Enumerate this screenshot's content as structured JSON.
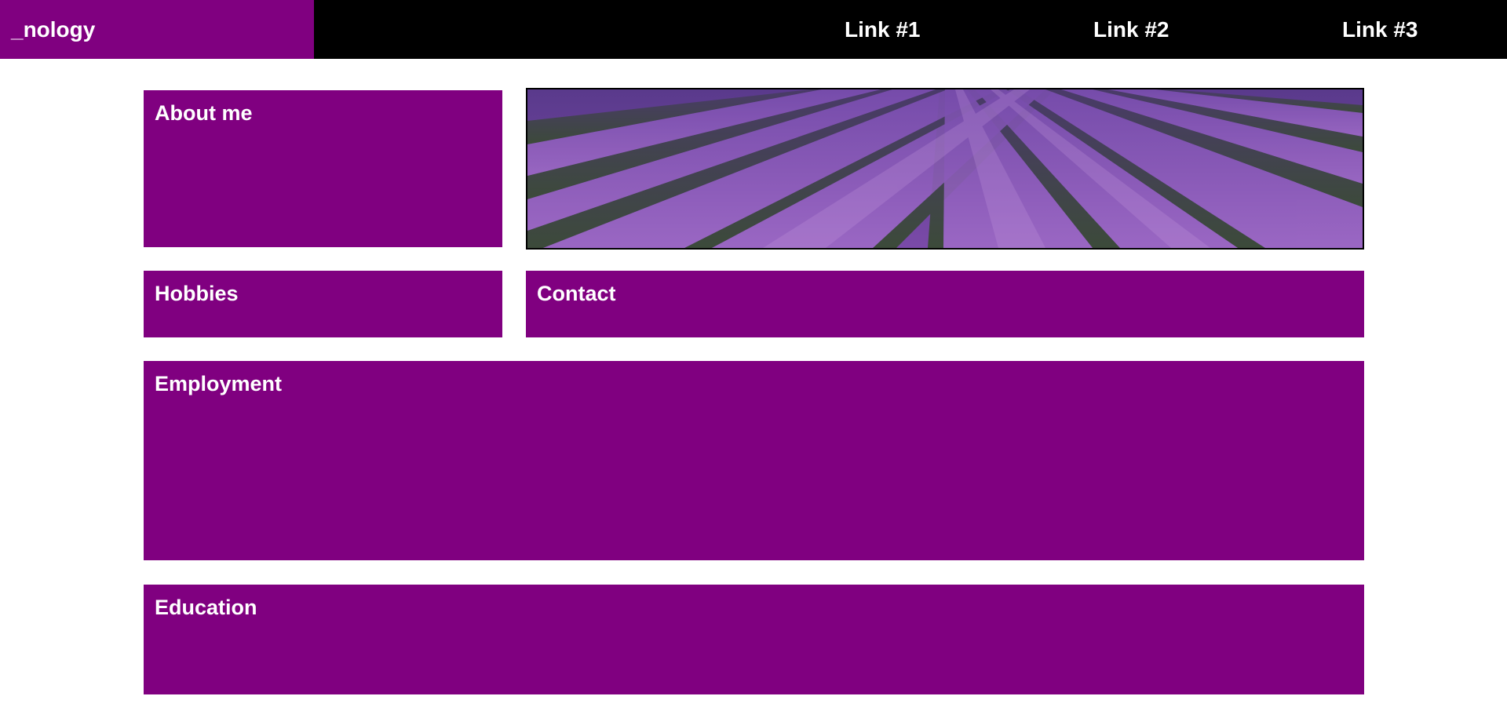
{
  "navbar": {
    "brand": "_nology",
    "links": [
      "Link #1",
      "Link #2",
      "Link #3"
    ]
  },
  "sections": {
    "about": "About me",
    "hobbies": "Hobbies",
    "contact": "Contact",
    "employment": "Employment",
    "education": "Education"
  },
  "hero": {
    "image": "lavender-field"
  },
  "colors": {
    "accent": "#800080",
    "nav_background": "#000000",
    "text": "#ffffff"
  }
}
